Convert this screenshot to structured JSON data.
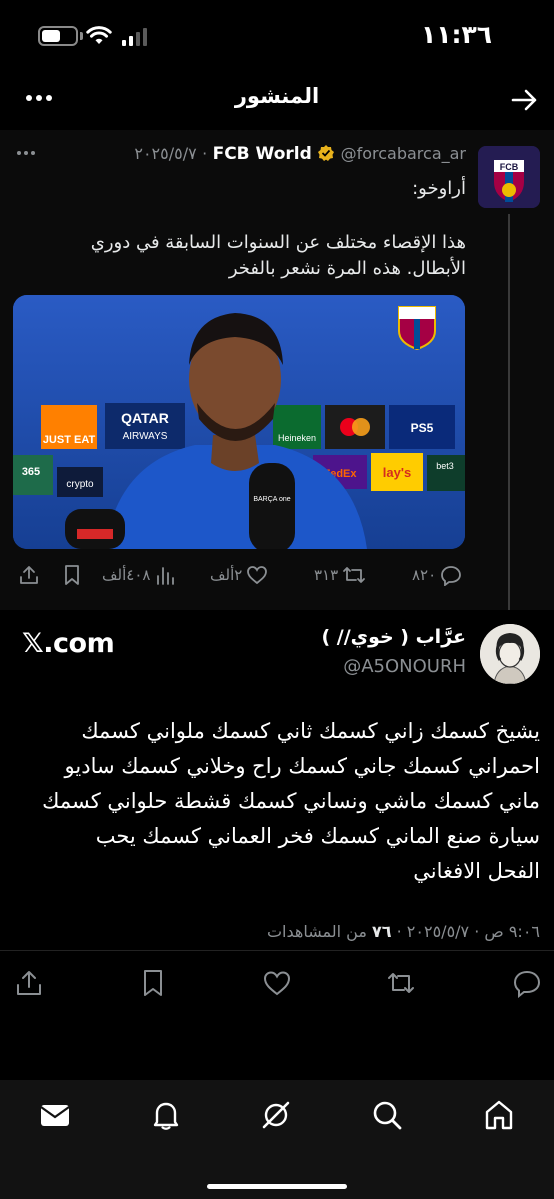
{
  "status_bar": {
    "time": "١١:٣٦",
    "battery_level": 0.55
  },
  "header": {
    "title": "المنشور"
  },
  "quoted_post": {
    "author_name": "FCB World",
    "author_handle": "@forcabarca_ar",
    "separator": "·",
    "date": "٢٠٢٥/٥/٧",
    "avatar_text": "FCB",
    "text_line1": "أراوخو:",
    "text_line2": "هذا الإقصاء مختلف عن السنوات السابقة في دوري",
    "text_line3": "الأبطال. هذه المرة نشعر بالفخر",
    "image_overlay": {
      "sponsor_justeat": "JUST EAT",
      "sponsor_qatar": "QATAR",
      "sponsor_airways": "AIRWAYS",
      "sponsor_heineken": "Heineken",
      "sponsor_ps5": "PS5",
      "sponsor_fedex": "FedEx",
      "sponsor_lays": "lay's",
      "sponsor_bet": "bet3",
      "sponsor_crypto": "crypto",
      "sponsor_365": "365",
      "mic_text": "BARÇA one"
    },
    "actions": {
      "replies": "٨٢٠",
      "retweets": "٣١٣",
      "likes": "٢ألف",
      "views": "٤٠٨ألف"
    }
  },
  "main_post": {
    "author_name": "عرَّاب ( خوي// )",
    "author_handle": "@A5ONOURH",
    "watermark": "𝕏.com",
    "text_lines": [
      "يشيخ كسمك زاني كسمك ثاني كسمك ملواني كسمك",
      "احمراني كسمك جاني كسمك راح وخلاني كسمك ساديو",
      "ماني كسمك ماشي ونساني كسمك قشطة حلواني كسمك",
      "سيارة صنع الماني كسمك فخر العماني كسمك يحب",
      "الفحل الافغاني"
    ],
    "meta_datetime": "٩:٠٦ ص · ٢٠٢٥/٥/٧",
    "meta_separator": "·",
    "meta_views_count": "٧٦",
    "meta_views_label": "من المشاهدات"
  },
  "bottom_nav": {
    "items": [
      "home-icon",
      "search-icon",
      "grok-icon",
      "notifications-icon",
      "messages-icon"
    ]
  }
}
